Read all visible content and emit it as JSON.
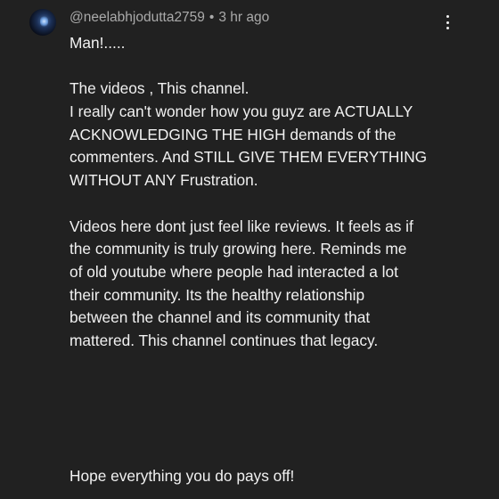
{
  "comment": {
    "author": "@neelabhjodutta2759",
    "separator": "•",
    "timestamp": "3 hr ago",
    "avatar_icon": "avatar-image",
    "menu_icon": "more-vert-icon",
    "lines": [
      "Man!.....",
      "",
      "The videos , This channel.",
      "I really can't wonder how you guyz are ACTUALLY",
      "ACKNOWLEDGING THE HIGH demands of the",
      "commenters. And STILL GIVE THEM EVERYTHING",
      "WITHOUT ANY Frustration.",
      "",
      "Videos here dont just feel like reviews. It feels as if",
      "the community is truly growing here. Reminds me",
      "of old youtube where people had interacted a lot",
      "their community. Its the healthy relationship",
      "between the channel and its community that",
      "mattered. This channel continues that legacy."
    ],
    "closing": "Hope everything you do pays off!"
  },
  "colors": {
    "background": "#212121",
    "text": "#f1f1f1",
    "meta_text": "#aaaaaa"
  }
}
